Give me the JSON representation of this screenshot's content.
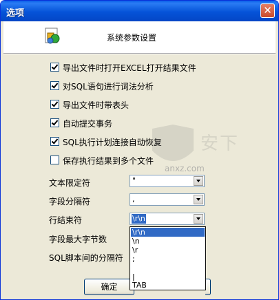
{
  "window": {
    "title": "选项",
    "close_icon": "close-icon"
  },
  "header": {
    "title": "系统参数设置",
    "icon": "settings-puzzle-icon"
  },
  "options": [
    {
      "label": "导出文件时打开EXCEL打开结果文件",
      "checked": true
    },
    {
      "label": "对SQL语句进行词法分析",
      "checked": true
    },
    {
      "label": "导出文件时带表头",
      "checked": true
    },
    {
      "label": "自动提交事务",
      "checked": true
    },
    {
      "label": "SQL执行计划连接自动恢复",
      "checked": true
    },
    {
      "label": "保存执行结果到多个文件",
      "checked": false
    }
  ],
  "fields": {
    "text_qualifier": {
      "label": "文本限定符",
      "value": "\""
    },
    "field_separator": {
      "label": "字段分隔符",
      "value": ","
    },
    "line_terminator": {
      "label": "行结束符",
      "value": "\\r\\n"
    },
    "max_field_bytes": {
      "label": "字段最大字节数"
    },
    "sql_separator": {
      "label": "SQL脚本间的分隔符"
    }
  },
  "dropdown": {
    "items": [
      "\\r\\n",
      "\\n",
      "\\r",
      ";",
      "",
      "|",
      "TAB"
    ],
    "selected_index": 0
  },
  "buttons": {
    "ok": "确定"
  },
  "watermark": {
    "text": "anxz.com",
    "icon": "watermark-shield-icon"
  }
}
